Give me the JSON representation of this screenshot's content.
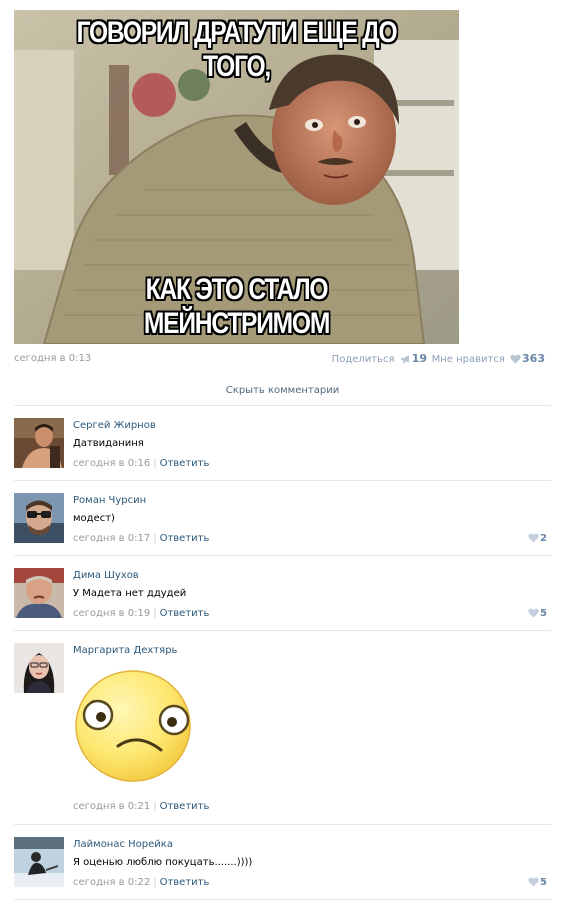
{
  "post": {
    "meme_top_text": "ГОВОРИЛ ДРАТУТИ ЕЩЕ ДО ТОГО,",
    "meme_bottom_text": "КАК ЭТО СТАЛО МЕЙНСТРИМОМ",
    "date": "сегодня в 0:13",
    "share_label": "Поделиться",
    "share_count": "19",
    "like_label": "Мне нравится",
    "like_count": "363"
  },
  "hide_comments_label": "Скрыть комментарии",
  "reply_label": "Ответить",
  "comments": [
    {
      "author": "Сергей Жирнов",
      "text": "Датвиданиня",
      "time": "сегодня в 0:16",
      "likes": ""
    },
    {
      "author": "Роман Чурсин",
      "text": "модест)",
      "time": "сегодня в 0:17",
      "likes": "2"
    },
    {
      "author": "Дима Шухов",
      "text": "У Мадета нет ддудей",
      "time": "сегодня в 0:19",
      "likes": "5"
    },
    {
      "author": "Маргарита Дехтярь",
      "text": "",
      "time": "сегодня в 0:21",
      "likes": ""
    },
    {
      "author": "Лаймонас Норейка",
      "text": "Я оценью люблю покуцать.......))))",
      "time": "сегодня в 0:22",
      "likes": "5"
    }
  ],
  "colors": {
    "link": "#2b587a",
    "meta": "#999999",
    "divider": "#e3e8ed",
    "like_accent": "#6a86a6"
  },
  "icons": {
    "share": "megaphone-icon",
    "like": "heart-icon",
    "sticker": "sad-smiley-sticker"
  }
}
